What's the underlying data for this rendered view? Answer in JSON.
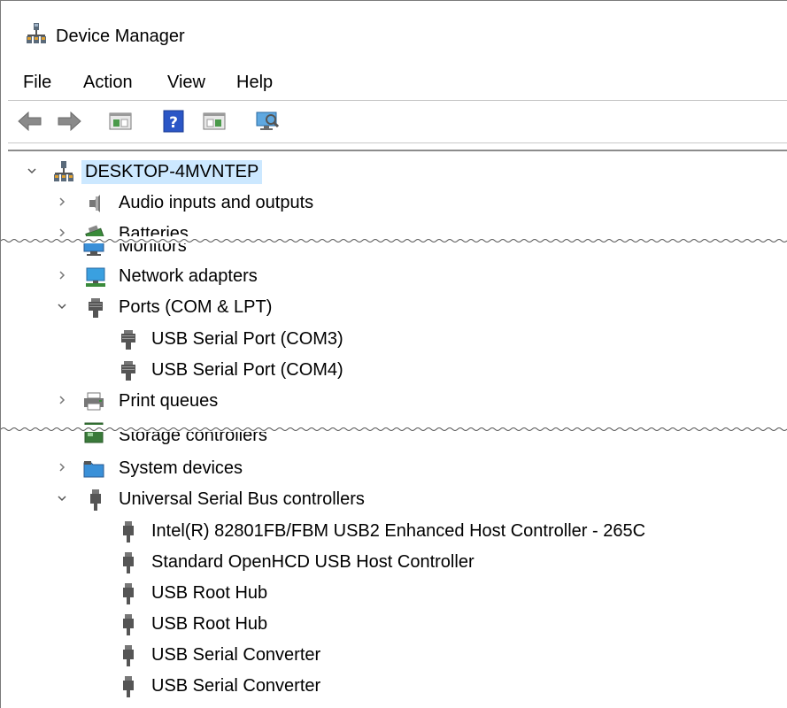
{
  "window": {
    "title": "Device Manager"
  },
  "menu": {
    "file": "File",
    "action": "Action",
    "view": "View",
    "help": "Help"
  },
  "toolbar": {
    "buttons": [
      "back-arrow-icon",
      "forward-arrow-icon",
      "properties-pane-icon",
      "help-icon",
      "update-driver-pane-icon",
      "scan-hardware-icon"
    ]
  },
  "tree": {
    "root": "DESKTOP-4MVNTEP",
    "top_section": {
      "audio": "Audio inputs and outputs",
      "batteries": "Batteries"
    },
    "middle_section": {
      "monitors": "Monitors",
      "network": "Network adapters",
      "ports": "Ports (COM & LPT)",
      "ports_children": [
        "USB Serial Port (COM3)",
        "USB Serial Port (COM4)"
      ],
      "print_queues": "Print queues"
    },
    "bottom_section": {
      "storage": "Storage controllers",
      "system": "System devices",
      "usb": "Universal Serial Bus controllers",
      "usb_children": [
        "Intel(R) 82801FB/FBM USB2 Enhanced Host Controller - 265C",
        "Standard OpenHCD USB Host Controller",
        "USB Root Hub",
        "USB Root Hub",
        "USB Serial Converter",
        "USB Serial Converter"
      ]
    }
  }
}
